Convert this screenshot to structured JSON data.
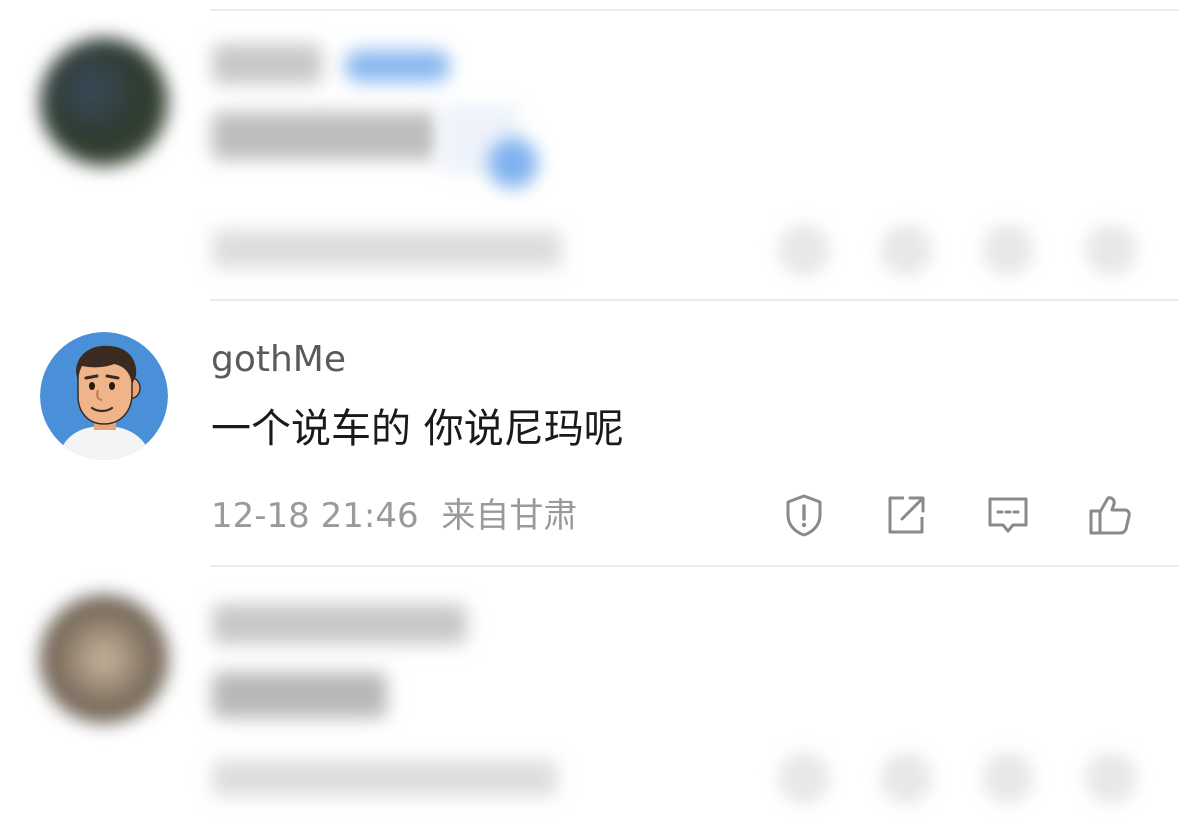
{
  "comment": {
    "username": "gothMe",
    "text": "一个说车的 你说尼玛呢",
    "time": "12-18 21:46",
    "location": "来自甘肃",
    "actions": [
      {
        "name": "report",
        "icon": "shield-exclamation-icon"
      },
      {
        "name": "share",
        "icon": "share-external-icon"
      },
      {
        "name": "reply",
        "icon": "comment-bubble-icon"
      },
      {
        "name": "like",
        "icon": "thumbs-up-icon"
      }
    ]
  },
  "colors": {
    "username": "#5a5a5a",
    "text": "#1a1a1a",
    "meta": "#9a9a9a",
    "icon": "#8a8a8a",
    "divider": "#ececec",
    "avatar_bg": "#4a90d9"
  }
}
